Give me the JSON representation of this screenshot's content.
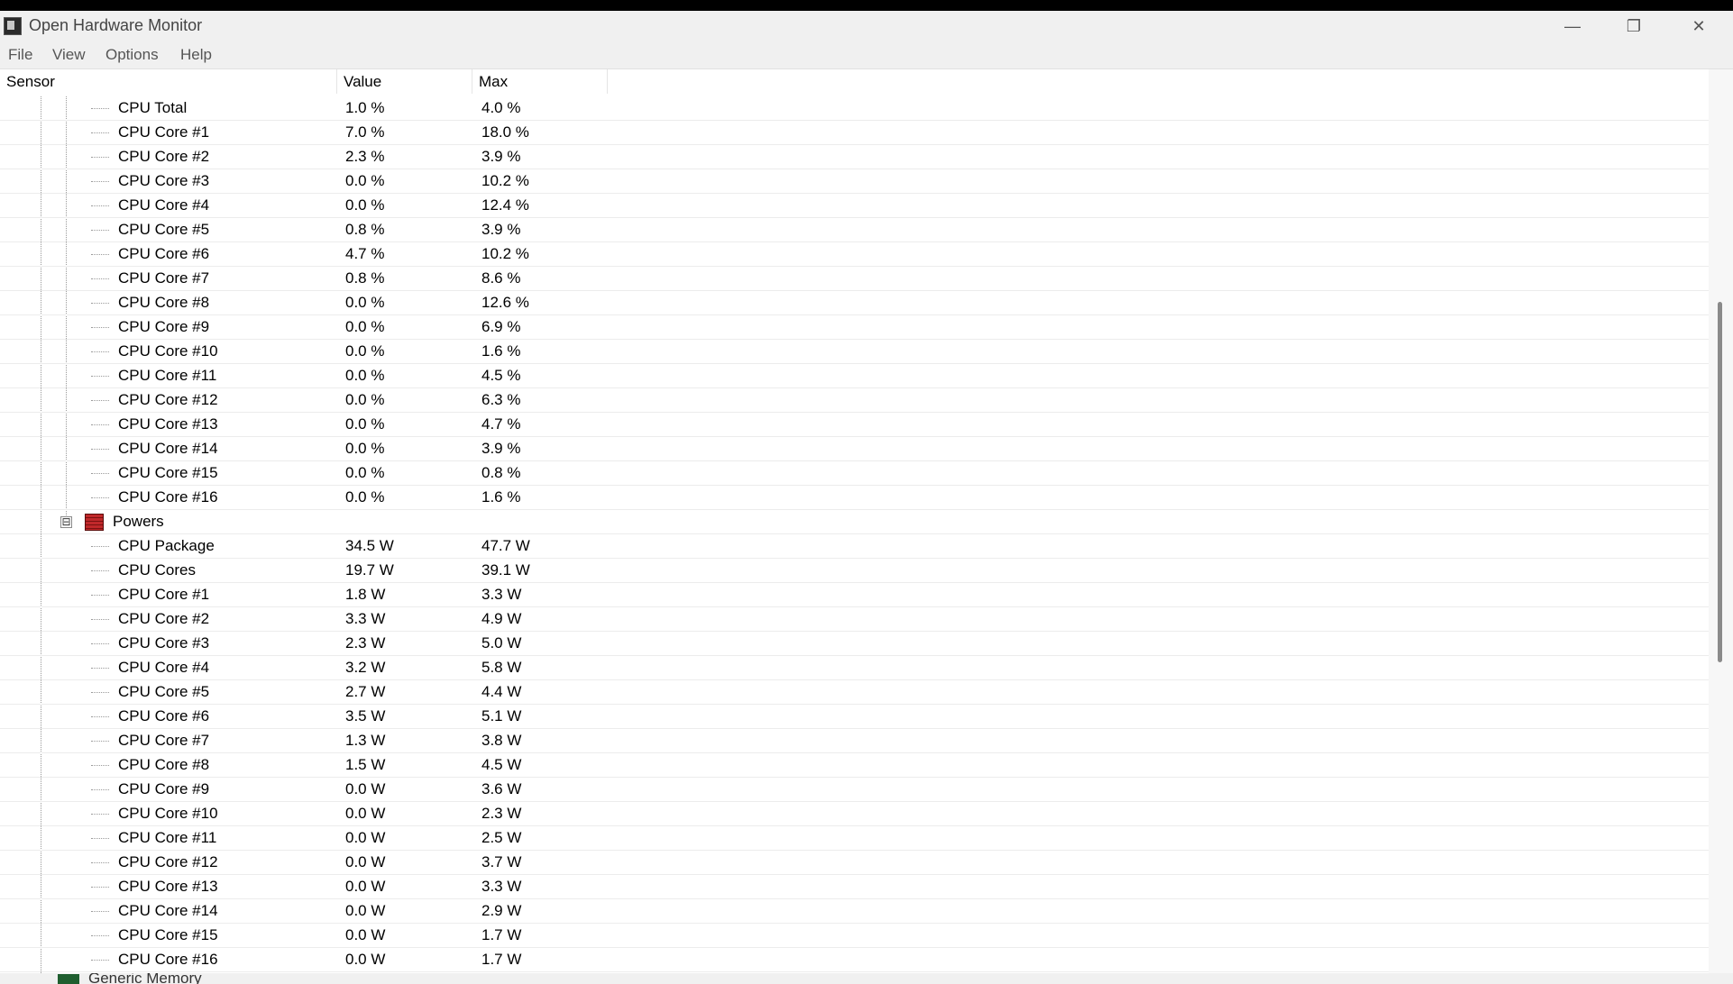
{
  "window": {
    "title": "Open Hardware Monitor",
    "controls": {
      "minimize": "—",
      "maximize": "❐",
      "close": "✕"
    }
  },
  "menu": {
    "file": "File",
    "view": "View",
    "options": "Options",
    "help": "Help"
  },
  "columns": {
    "sensor": "Sensor",
    "value": "Value",
    "max": "Max"
  },
  "rows": [
    {
      "name": "CPU Total",
      "value": "1.0 %",
      "max": "4.0 %"
    },
    {
      "name": "CPU Core #1",
      "value": "7.0 %",
      "max": "18.0 %"
    },
    {
      "name": "CPU Core #2",
      "value": "2.3 %",
      "max": "3.9 %"
    },
    {
      "name": "CPU Core #3",
      "value": "0.0 %",
      "max": "10.2 %"
    },
    {
      "name": "CPU Core #4",
      "value": "0.0 %",
      "max": "12.4 %"
    },
    {
      "name": "CPU Core #5",
      "value": "0.8 %",
      "max": "3.9 %"
    },
    {
      "name": "CPU Core #6",
      "value": "4.7 %",
      "max": "10.2 %"
    },
    {
      "name": "CPU Core #7",
      "value": "0.8 %",
      "max": "8.6 %"
    },
    {
      "name": "CPU Core #8",
      "value": "0.0 %",
      "max": "12.6 %"
    },
    {
      "name": "CPU Core #9",
      "value": "0.0 %",
      "max": "6.9 %"
    },
    {
      "name": "CPU Core #10",
      "value": "0.0 %",
      "max": "1.6 %"
    },
    {
      "name": "CPU Core #11",
      "value": "0.0 %",
      "max": "4.5 %"
    },
    {
      "name": "CPU Core #12",
      "value": "0.0 %",
      "max": "6.3 %"
    },
    {
      "name": "CPU Core #13",
      "value": "0.0 %",
      "max": "4.7 %"
    },
    {
      "name": "CPU Core #14",
      "value": "0.0 %",
      "max": "3.9 %"
    },
    {
      "name": "CPU Core #15",
      "value": "0.0 %",
      "max": "0.8 %"
    },
    {
      "name": "CPU Core #16",
      "value": "0.0 %",
      "max": "1.6 %"
    },
    {
      "group": "Powers",
      "expander": "⊟",
      "icon": "power-sensor-icon"
    },
    {
      "name": "CPU Package",
      "value": "34.5 W",
      "max": "47.7 W"
    },
    {
      "name": "CPU Cores",
      "value": "19.7 W",
      "max": "39.1 W"
    },
    {
      "name": "CPU Core #1",
      "value": "1.8 W",
      "max": "3.3 W"
    },
    {
      "name": "CPU Core #2",
      "value": "3.3 W",
      "max": "4.9 W"
    },
    {
      "name": "CPU Core #3",
      "value": "2.3 W",
      "max": "5.0 W"
    },
    {
      "name": "CPU Core #4",
      "value": "3.2 W",
      "max": "5.8 W"
    },
    {
      "name": "CPU Core #5",
      "value": "2.7 W",
      "max": "4.4 W"
    },
    {
      "name": "CPU Core #6",
      "value": "3.5 W",
      "max": "5.1 W"
    },
    {
      "name": "CPU Core #7",
      "value": "1.3 W",
      "max": "3.8 W"
    },
    {
      "name": "CPU Core #8",
      "value": "1.5 W",
      "max": "4.5 W"
    },
    {
      "name": "CPU Core #9",
      "value": "0.0 W",
      "max": "3.6 W"
    },
    {
      "name": "CPU Core #10",
      "value": "0.0 W",
      "max": "2.3 W"
    },
    {
      "name": "CPU Core #11",
      "value": "0.0 W",
      "max": "2.5 W"
    },
    {
      "name": "CPU Core #12",
      "value": "0.0 W",
      "max": "3.7 W"
    },
    {
      "name": "CPU Core #13",
      "value": "0.0 W",
      "max": "3.3 W"
    },
    {
      "name": "CPU Core #14",
      "value": "0.0 W",
      "max": "2.9 W"
    },
    {
      "name": "CPU Core #15",
      "value": "0.0 W",
      "max": "1.7 W"
    },
    {
      "name": "CPU Core #16",
      "value": "0.0 W",
      "max": "1.7 W"
    }
  ],
  "partial_bottom_row": {
    "name": "Generic Memory",
    "icon": "memory-icon"
  },
  "colors": {
    "powers_icon": "#c0282a",
    "memory_icon": "#1f5e2f",
    "title_bar": "#f0f0f0"
  }
}
